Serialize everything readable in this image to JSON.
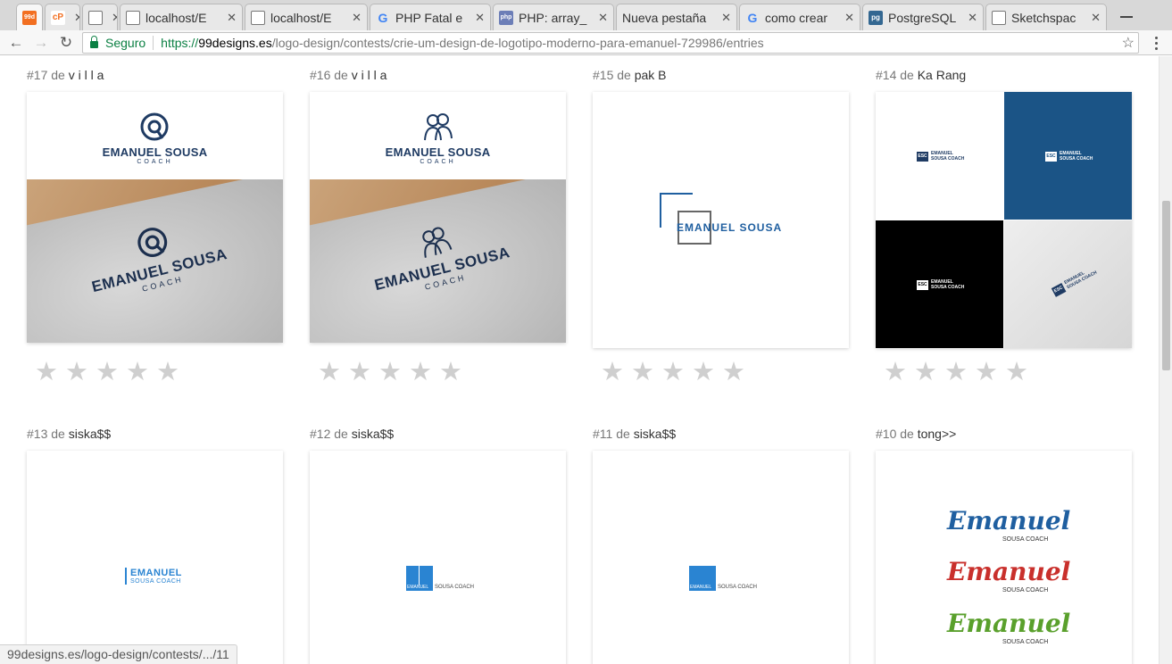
{
  "tabs": [
    {
      "title": "",
      "favicon": "99d",
      "color": "#f26f21",
      "active": true
    },
    {
      "title": "",
      "favicon": "cP",
      "color": "#f26f21"
    },
    {
      "title": "",
      "favicon": "page",
      "color": "#888"
    },
    {
      "title": "localhost/E",
      "favicon": "page",
      "color": "#888"
    },
    {
      "title": "localhost/E",
      "favicon": "page",
      "color": "#888"
    },
    {
      "title": "PHP Fatal e",
      "favicon": "G",
      "color": "#4285f4"
    },
    {
      "title": "PHP: array_",
      "favicon": "php",
      "color": "#6c7eb7"
    },
    {
      "title": "Nueva pestaña",
      "favicon": "",
      "color": "#888"
    },
    {
      "title": "como crear",
      "favicon": "G",
      "color": "#4285f4"
    },
    {
      "title": "PostgreSQL",
      "favicon": "pg",
      "color": "#336791"
    },
    {
      "title": "Sketchspac",
      "favicon": "page",
      "color": "#888"
    }
  ],
  "toolbar": {
    "secure_label": "Seguro",
    "url_scheme": "https://",
    "url_host": "99designs.es",
    "url_path": "/logo-design/contests/crie-um-design-de-logotipo-moderno-para-emanuel-729986/entries"
  },
  "entries": [
    {
      "number": "#17",
      "by": "de",
      "designer": "v i l l a"
    },
    {
      "number": "#16",
      "by": "de",
      "designer": "v i l l a"
    },
    {
      "number": "#15",
      "by": "de",
      "designer": "pak B"
    },
    {
      "number": "#14",
      "by": "de",
      "designer": "Ka Rang"
    },
    {
      "number": "#13",
      "by": "de",
      "designer": "siska$$"
    },
    {
      "number": "#12",
      "by": "de",
      "designer": "siska$$"
    },
    {
      "number": "#11",
      "by": "de",
      "designer": "siska$$"
    },
    {
      "number": "#10",
      "by": "de",
      "designer": "tong>>"
    }
  ],
  "logos": {
    "brand_main": "EMANUEL SOUSA",
    "brand_sub": "COACH",
    "brand_15": "EMANUEL SOUSA",
    "esc": "ESC",
    "mini_line1": "EMANUEL",
    "mini_line2": "SOUSA COACH",
    "s13_line1": "EMANUEL",
    "s13_line2": "SOUSA COACH",
    "s12_tag": "EMANUEL",
    "s12_sub": "SOUSA COACH",
    "s11_tag": "EMANUEL",
    "s11_sub": "SOUSA COACH",
    "script_word": "Emanuel",
    "script_sub": "SOUSA COACH"
  },
  "rating": {
    "stars_total": 5,
    "stars_filled": 0
  },
  "status_url": "99designs.es/logo-design/contests/.../11",
  "colors": {
    "navy": "#1f3b63",
    "blue": "#2a84d2",
    "red": "#c9302c",
    "green": "#5aa02c"
  }
}
